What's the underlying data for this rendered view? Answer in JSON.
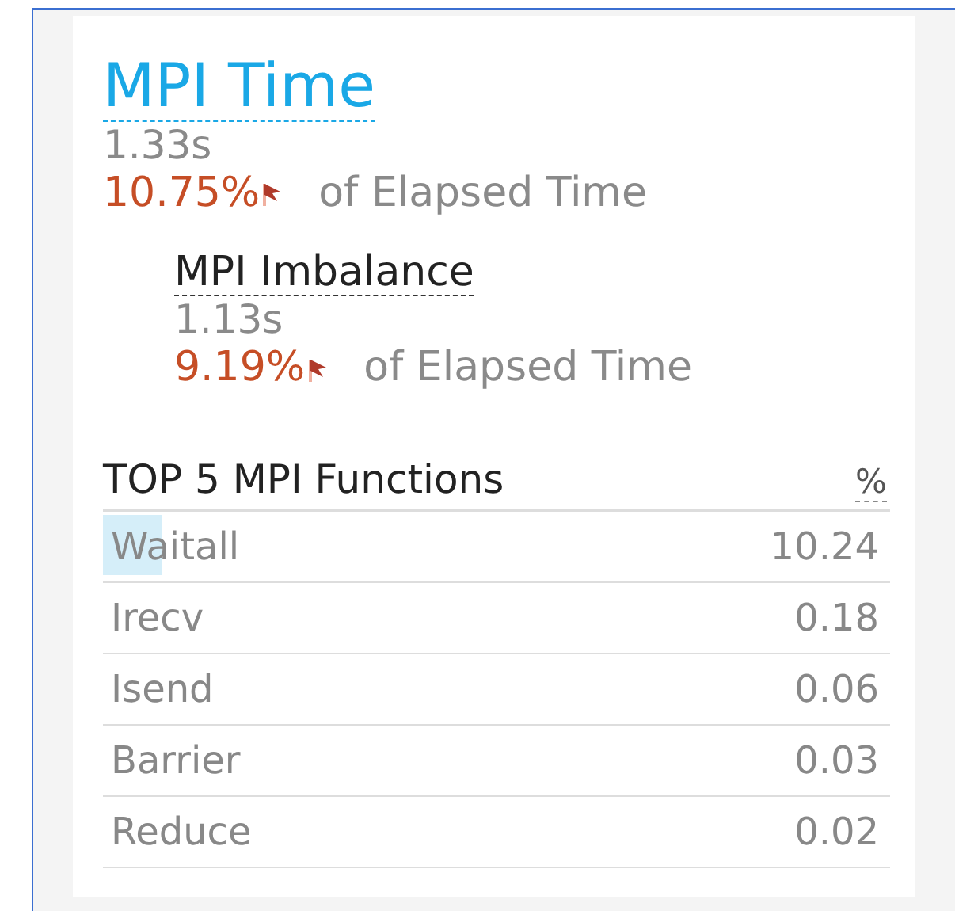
{
  "metric": {
    "title": "MPI Time",
    "value": "1.33s",
    "percent": "10.75%",
    "percent_suffix": "of Elapsed Time",
    "flagged": true
  },
  "sub_metric": {
    "title": "MPI Imbalance",
    "value": "1.13s",
    "percent": "9.19%",
    "percent_suffix": "of Elapsed Time",
    "flagged": true
  },
  "table": {
    "title": "TOP 5 MPI Functions",
    "value_header": "%",
    "rows": [
      {
        "name": "Waitall",
        "value": "10.24",
        "highlighted": true
      },
      {
        "name": "Irecv",
        "value": "0.18",
        "highlighted": false
      },
      {
        "name": "Isend",
        "value": "0.06",
        "highlighted": false
      },
      {
        "name": "Barrier",
        "value": "0.03",
        "highlighted": false
      },
      {
        "name": "Reduce",
        "value": "0.02",
        "highlighted": false
      }
    ]
  }
}
